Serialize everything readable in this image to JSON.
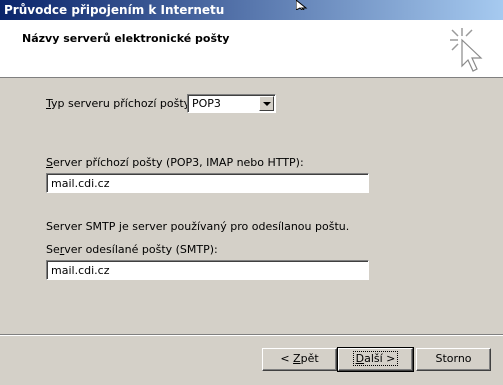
{
  "window": {
    "title": "Průvodce připojením k Internetu"
  },
  "header": {
    "title": "Názvy serverů elektronické pošty",
    "icon": "wizard-pointer-sparkle-icon"
  },
  "form": {
    "incoming_type_label_accel": "T",
    "incoming_type_label_rest": "yp serveru příchozí pošty:",
    "incoming_type_value": "POP3",
    "incoming_server_label_accel": "S",
    "incoming_server_label_rest": "erver příchozí pošty (POP3, IMAP nebo HTTP):",
    "incoming_server_value": "mail.cdi.cz",
    "smtp_info": "Server SMTP je server používaný pro odesílanou poštu.",
    "outgoing_server_label_pre": "Se",
    "outgoing_server_label_accel": "r",
    "outgoing_server_label_rest": "ver odesílané pošty (SMTP):",
    "outgoing_server_value": "mail.cdi.cz"
  },
  "buttons": {
    "back_pre": "< ",
    "back_accel": "Z",
    "back_rest": "pět",
    "next_accel": "D",
    "next_rest": "alší >",
    "cancel": "Storno"
  },
  "colors": {
    "titlebar_start": "#0a246a",
    "titlebar_end": "#a6caf0",
    "dialog_bg": "#d4d0c8"
  }
}
